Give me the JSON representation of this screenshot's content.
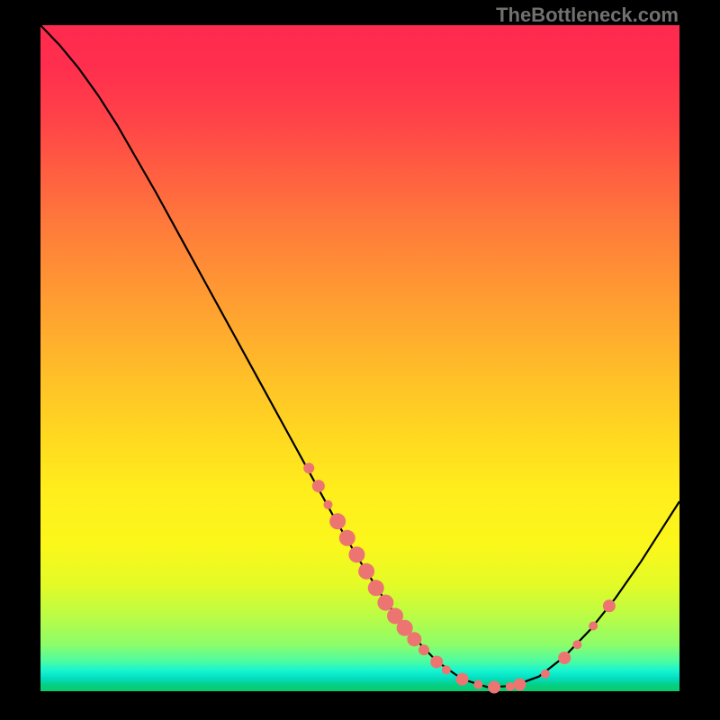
{
  "attribution": "TheBottleneck.com",
  "chart_data": {
    "type": "line",
    "title": "",
    "xlabel": "",
    "ylabel": "",
    "xlim": [
      0,
      100
    ],
    "ylim": [
      0,
      100
    ],
    "grid": false,
    "legend": false,
    "curve": [
      {
        "x": 0.0,
        "y": 100.0
      },
      {
        "x": 3.0,
        "y": 97.0
      },
      {
        "x": 6.0,
        "y": 93.5
      },
      {
        "x": 9.0,
        "y": 89.5
      },
      {
        "x": 12.0,
        "y": 85.0
      },
      {
        "x": 15.0,
        "y": 80.0
      },
      {
        "x": 18.0,
        "y": 75.0
      },
      {
        "x": 22.0,
        "y": 68.0
      },
      {
        "x": 26.0,
        "y": 61.0
      },
      {
        "x": 30.0,
        "y": 54.0
      },
      {
        "x": 34.0,
        "y": 47.0
      },
      {
        "x": 38.0,
        "y": 40.0
      },
      {
        "x": 42.0,
        "y": 33.0
      },
      {
        "x": 46.0,
        "y": 26.0
      },
      {
        "x": 50.0,
        "y": 19.5
      },
      {
        "x": 54.0,
        "y": 13.5
      },
      {
        "x": 58.0,
        "y": 8.5
      },
      {
        "x": 62.0,
        "y": 4.5
      },
      {
        "x": 66.0,
        "y": 1.8
      },
      {
        "x": 70.0,
        "y": 0.6
      },
      {
        "x": 74.0,
        "y": 0.8
      },
      {
        "x": 78.0,
        "y": 2.2
      },
      {
        "x": 82.0,
        "y": 5.2
      },
      {
        "x": 86.0,
        "y": 9.2
      },
      {
        "x": 90.0,
        "y": 14.0
      },
      {
        "x": 94.0,
        "y": 19.5
      },
      {
        "x": 98.0,
        "y": 25.5
      },
      {
        "x": 100.0,
        "y": 28.5
      }
    ],
    "markers": [
      {
        "x": 42.0,
        "y": 33.5,
        "r": 6
      },
      {
        "x": 43.5,
        "y": 30.8,
        "r": 7
      },
      {
        "x": 45.0,
        "y": 28.0,
        "r": 5
      },
      {
        "x": 46.5,
        "y": 25.5,
        "r": 9
      },
      {
        "x": 48.0,
        "y": 23.0,
        "r": 9
      },
      {
        "x": 49.5,
        "y": 20.5,
        "r": 9
      },
      {
        "x": 51.0,
        "y": 18.0,
        "r": 9
      },
      {
        "x": 52.5,
        "y": 15.5,
        "r": 9
      },
      {
        "x": 54.0,
        "y": 13.3,
        "r": 9
      },
      {
        "x": 55.5,
        "y": 11.3,
        "r": 9
      },
      {
        "x": 57.0,
        "y": 9.5,
        "r": 9
      },
      {
        "x": 58.5,
        "y": 7.8,
        "r": 8
      },
      {
        "x": 60.0,
        "y": 6.2,
        "r": 6
      },
      {
        "x": 62.0,
        "y": 4.4,
        "r": 7
      },
      {
        "x": 63.5,
        "y": 3.2,
        "r": 5
      },
      {
        "x": 66.0,
        "y": 1.8,
        "r": 7
      },
      {
        "x": 68.5,
        "y": 1.0,
        "r": 5
      },
      {
        "x": 71.0,
        "y": 0.6,
        "r": 7
      },
      {
        "x": 73.5,
        "y": 0.7,
        "r": 5
      },
      {
        "x": 75.0,
        "y": 1.0,
        "r": 7
      },
      {
        "x": 79.0,
        "y": 2.6,
        "r": 5
      },
      {
        "x": 82.0,
        "y": 5.0,
        "r": 7
      },
      {
        "x": 84.0,
        "y": 7.0,
        "r": 5
      },
      {
        "x": 86.5,
        "y": 9.8,
        "r": 5
      },
      {
        "x": 89.0,
        "y": 12.8,
        "r": 7
      }
    ],
    "colors": {
      "line": "#000000",
      "marker": "#ec7571"
    }
  }
}
